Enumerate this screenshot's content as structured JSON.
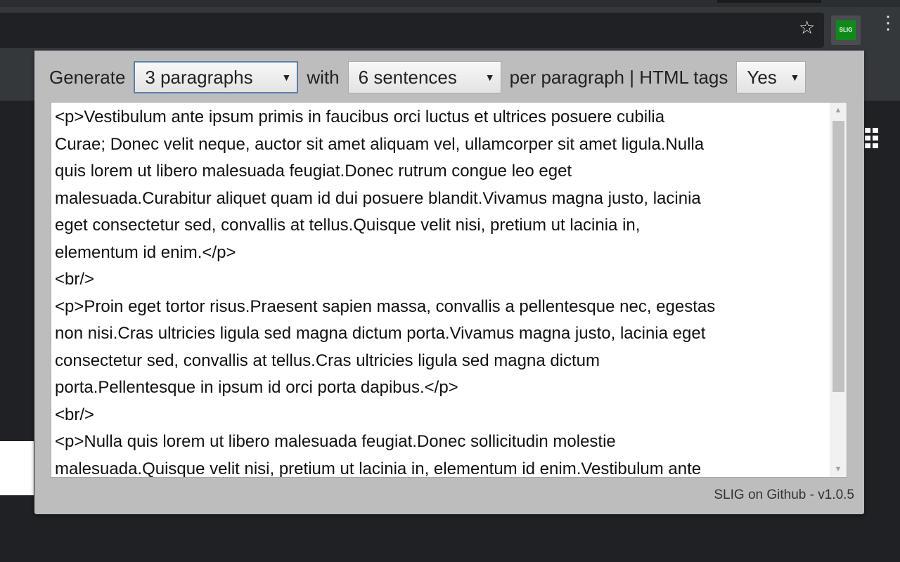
{
  "browser": {
    "bookmark_icon": "star-outline-icon",
    "extension_label": "SLIG",
    "extension_color": "#0f8a1a",
    "menu_icon": "vertical-dots-icon",
    "page_icon": "grid-icon"
  },
  "popup": {
    "generate_label": "Generate",
    "paragraphs_select": "3 paragraphs",
    "with_label": "with",
    "sentences_select": "6 sentences",
    "per_paragraph_label": "per paragraph | HTML tags",
    "html_tags_select": "Yes",
    "output_lines": [
      "<p>Vestibulum ante ipsum primis in faucibus orci luctus et ultrices posuere cubilia",
      "Curae; Donec velit neque, auctor sit amet aliquam vel, ullamcorper sit amet ligula.Nulla",
      "quis lorem ut libero malesuada feugiat.Donec rutrum congue leo eget",
      "malesuada.Curabitur aliquet quam id dui posuere blandit.Vivamus magna justo, lacinia",
      "eget consectetur sed, convallis at tellus.Quisque velit nisi, pretium ut lacinia in,",
      "elementum id enim.</p>",
      "<br/>",
      "<p>Proin eget tortor risus.Praesent sapien massa, convallis a pellentesque nec, egestas",
      "non nisi.Cras ultricies ligula sed magna dictum porta.Vivamus magna justo, lacinia eget",
      "consectetur sed, convallis at tellus.Cras ultricies ligula sed magna dictum",
      "porta.Pellentesque in ipsum id orci porta dapibus.</p>",
      "<br/>",
      "<p>Nulla quis lorem ut libero malesuada feugiat.Donec sollicitudin molestie",
      "malesuada.Quisque velit nisi, pretium ut lacinia in, elementum id enim.Vestibulum ante"
    ],
    "footer_link": "SLIG on Github - v1.0.5"
  }
}
